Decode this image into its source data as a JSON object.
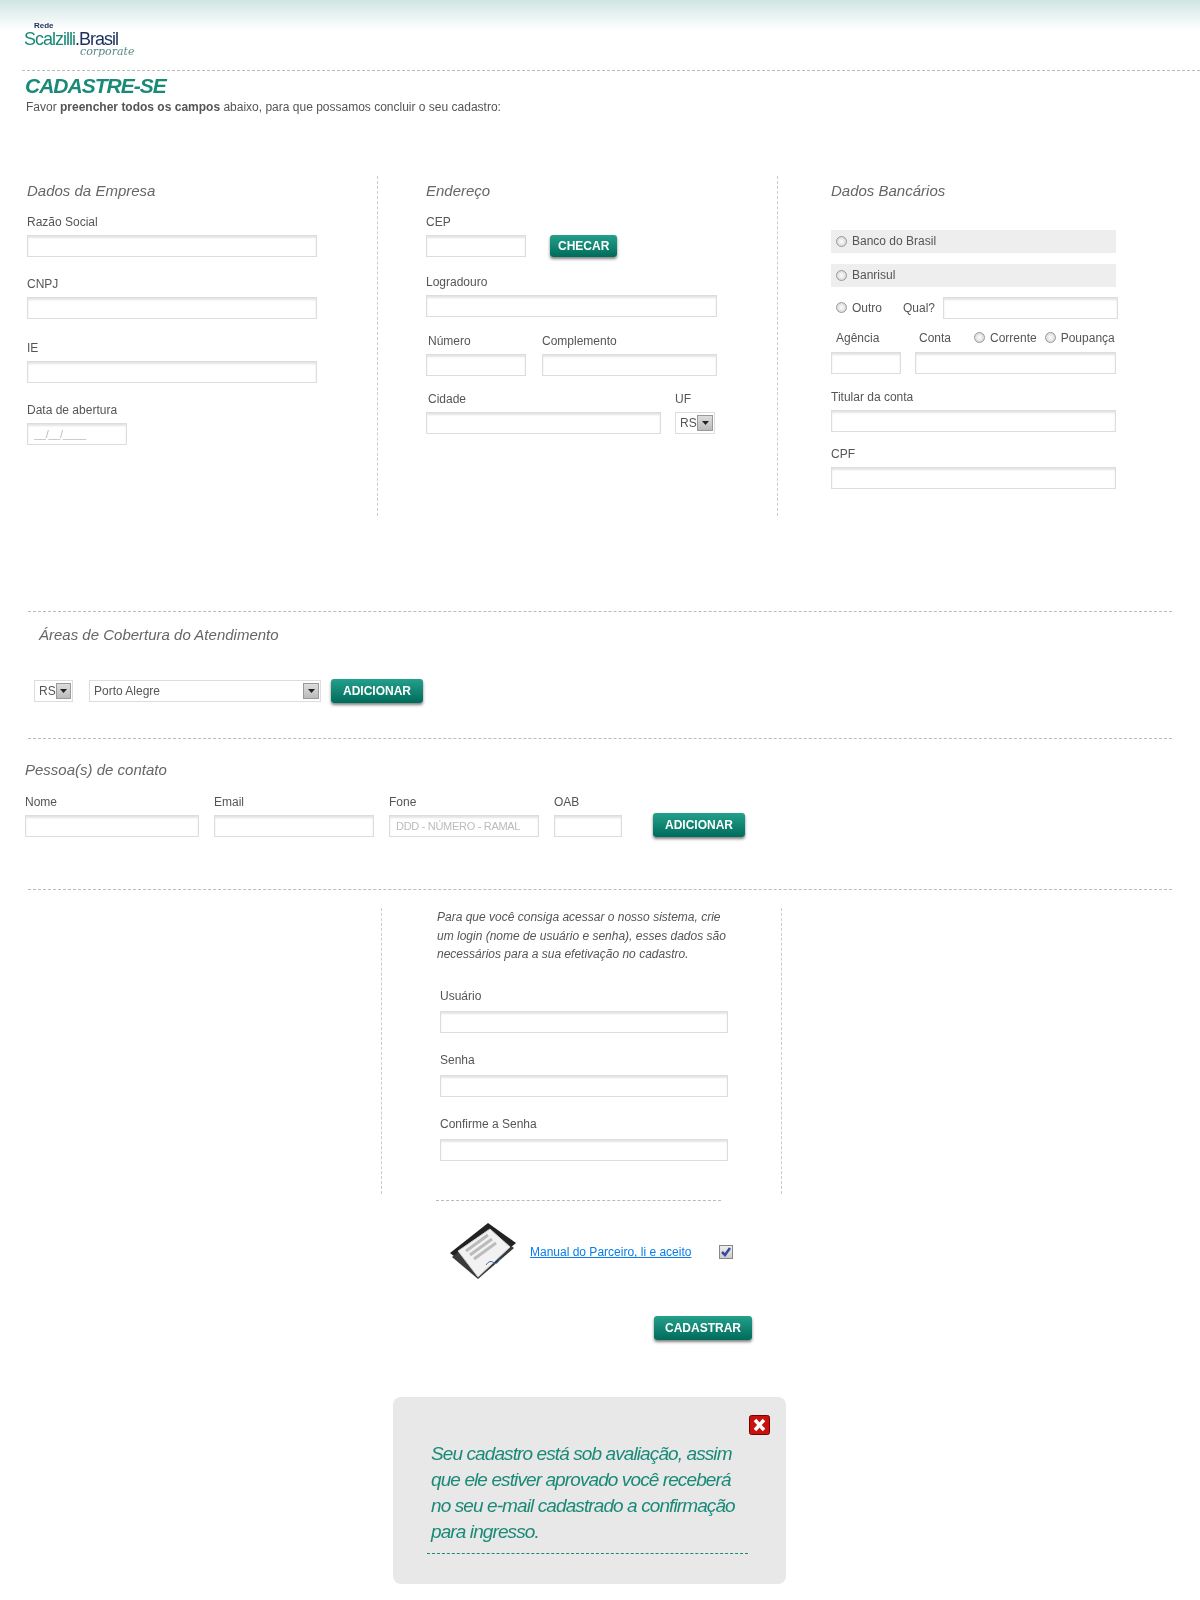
{
  "logo": {
    "prefix": "Rede",
    "name": "Scalzilli",
    "suffix": ".Brasil",
    "tagline": "corporate"
  },
  "title": "CADASTRE-SE",
  "intro": "Favor **preencher todos os campos** abaixo, para que possamos concluir o seu cadastro:",
  "company": {
    "heading": "Dados da Empresa",
    "fields": [
      {
        "label": "Razão Social",
        "kind": "wide"
      },
      {
        "label": "CNPJ",
        "kind": "wide"
      },
      {
        "label": "IE",
        "kind": "wide"
      },
      {
        "label": "Data de abertura",
        "kind": "short",
        "placeholder": "__/__/____"
      }
    ]
  },
  "address": {
    "heading": "Endereço",
    "cep_label": "CEP",
    "check_button": "CHECAR",
    "street_label": "Logradouro",
    "number_label": "Número",
    "complement_label": "Complemento",
    "city_label": "Cidade",
    "state_label": "UF",
    "state_value": "RS"
  },
  "bank": {
    "heading": "Dados Bancários",
    "options": [
      {
        "label": "Banco do Brasil",
        "kind": "shaded",
        "selected": false
      },
      {
        "label": "Banrisul",
        "kind": "shaded",
        "selected": false
      },
      {
        "label": "Outro",
        "kind": "other",
        "selected": false
      }
    ],
    "other_label": "Qual?",
    "branch_label": "Agência",
    "account_label": "Conta",
    "account_types": [
      {
        "label": "Corrente",
        "selected": false
      },
      {
        "label": "Poupança",
        "selected": false
      }
    ],
    "holder_label": "Titular da conta",
    "cpf_label": "CPF"
  },
  "coverage": {
    "heading": "Áreas de Cobertura do Atendimento",
    "state_value": "RS",
    "city_value": "Porto Alegre",
    "button": "ADICIONAR"
  },
  "contacts": {
    "heading": "Pessoa(s) de contato",
    "fields": [
      {
        "label": "Nome",
        "kind": "name"
      },
      {
        "label": "Email",
        "kind": "email"
      },
      {
        "label": "Fone",
        "kind": "phone",
        "placeholder": "DDD - NÚMERO - RAMAL"
      },
      {
        "label": "OAB",
        "kind": "oab"
      }
    ],
    "button": "ADICIONAR"
  },
  "login": {
    "note": "Para que você consiga acessar o nosso sistema, crie um login (nome de usuário e senha), esses dados são necessários para a sua efetivação no cadastro.",
    "fields": [
      {
        "label": "Usuário"
      },
      {
        "label": "Senha"
      },
      {
        "label": "Confirme a Senha"
      }
    ]
  },
  "terms": {
    "link": "Manual do Parceiro, li e aceito",
    "checked": true
  },
  "submit": "CADASTRAR",
  "notice": {
    "text": "Seu cadastro está sob avaliação, assim que ele estiver aprovado você receberá no seu e-mail cadastrado a confirmação para ingresso."
  }
}
